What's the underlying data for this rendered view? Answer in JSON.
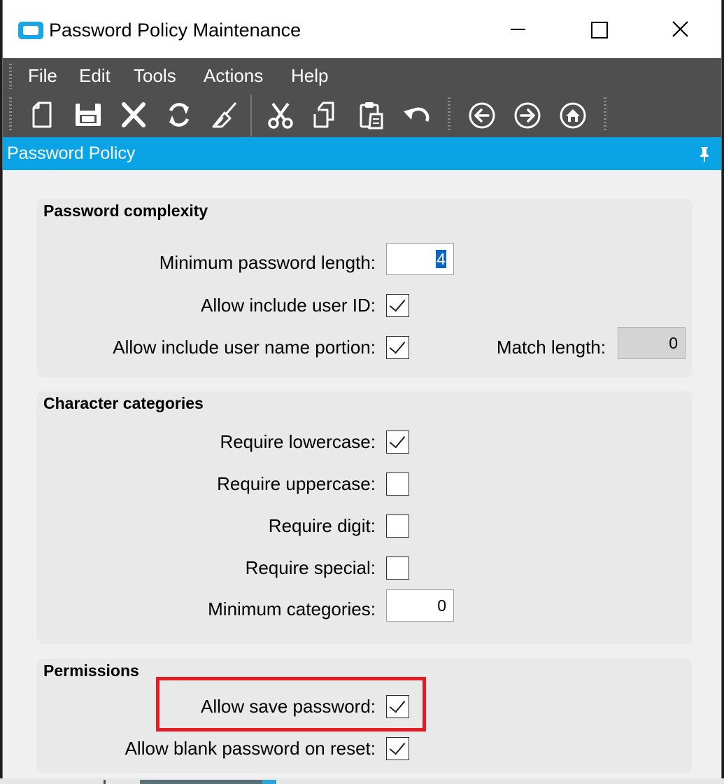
{
  "window": {
    "title": "Password Policy Maintenance",
    "controls": {
      "minimize": "minimize-icon",
      "maximize": "maximize-icon",
      "close": "close-icon"
    }
  },
  "menu": [
    "File",
    "Edit",
    "Tools",
    "Actions",
    "Help"
  ],
  "toolbar": {
    "icons": [
      "new-icon",
      "save-icon",
      "delete-icon",
      "refresh-icon",
      "clear-icon",
      "cut-icon",
      "copy-icon",
      "paste-icon",
      "undo-icon",
      "back-icon",
      "forward-icon",
      "home-icon"
    ]
  },
  "panel": {
    "title": "Password Policy",
    "pin_icon": "pin-icon"
  },
  "complexity": {
    "title": "Password complexity",
    "min_length_label": "Minimum password length:",
    "min_length_value": "4",
    "allow_user_id_label": "Allow include user ID:",
    "allow_user_id_checked": true,
    "allow_user_name_label": "Allow include user name portion:",
    "allow_user_name_checked": true,
    "match_length_label": "Match length:",
    "match_length_value": "0"
  },
  "categories": {
    "title": "Character categories",
    "lowercase_label": "Require lowercase:",
    "lowercase_checked": true,
    "uppercase_label": "Require uppercase:",
    "uppercase_checked": false,
    "digit_label": "Require digit:",
    "digit_checked": false,
    "special_label": "Require special:",
    "special_checked": false,
    "min_categories_label": "Minimum categories:",
    "min_categories_value": "0"
  },
  "permissions": {
    "title": "Permissions",
    "save_password_label": "Allow save password:",
    "save_password_checked": true,
    "blank_password_label": "Allow blank password on reset:",
    "blank_password_checked": true
  },
  "colors": {
    "panel_header": "#0aa4e6",
    "toolbar": "#4f4f4f",
    "highlight": "#e31b23"
  }
}
